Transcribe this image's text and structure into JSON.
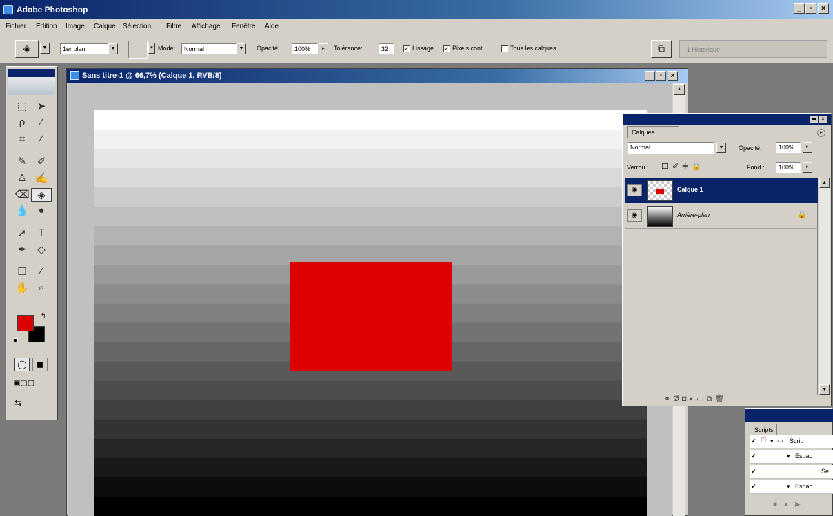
{
  "app": {
    "title": "Adobe Photoshop"
  },
  "menu": [
    "Fichier",
    "Edition",
    "Image",
    "Calque",
    "Sélection",
    "Filtre",
    "Affichage",
    "Fenêtre",
    "Aide"
  ],
  "options": {
    "fill_source": "1er plan",
    "mode_label": "Mode:",
    "mode_value": "Normal",
    "opacity_label": "Opacité:",
    "opacity_value": "100%",
    "tolerance_label": "Tolérance:",
    "tolerance_value": "32",
    "lissage_label": "Lissage",
    "pixels_label": "Pixels cont.",
    "tous_label": "Tous les calques",
    "history_label": "1 Historique"
  },
  "document": {
    "title": "Sans titre-1 @ 66,7% (Calque 1, RVB/8)"
  },
  "layers": {
    "tab": "Calques",
    "blend_mode": "Normal",
    "opacity_label": "Opacité:",
    "opacity_value": "100%",
    "lock_label": "Verrou :",
    "fill_label": "Fond :",
    "fill_value": "100%",
    "items": [
      {
        "name": "Calque 1",
        "selected": true
      },
      {
        "name": "Arrière-plan",
        "selected": false
      }
    ]
  },
  "scripts": {
    "tab": "Scripts",
    "rows": [
      "Scrip",
      "Espac",
      "Se",
      "Espac"
    ]
  },
  "colors": {
    "foreground": "#dc0000",
    "background": "#000000",
    "canvas_shape": "#dc0000",
    "titlebar": "#0a246a",
    "panel": "#d4d0c8"
  }
}
